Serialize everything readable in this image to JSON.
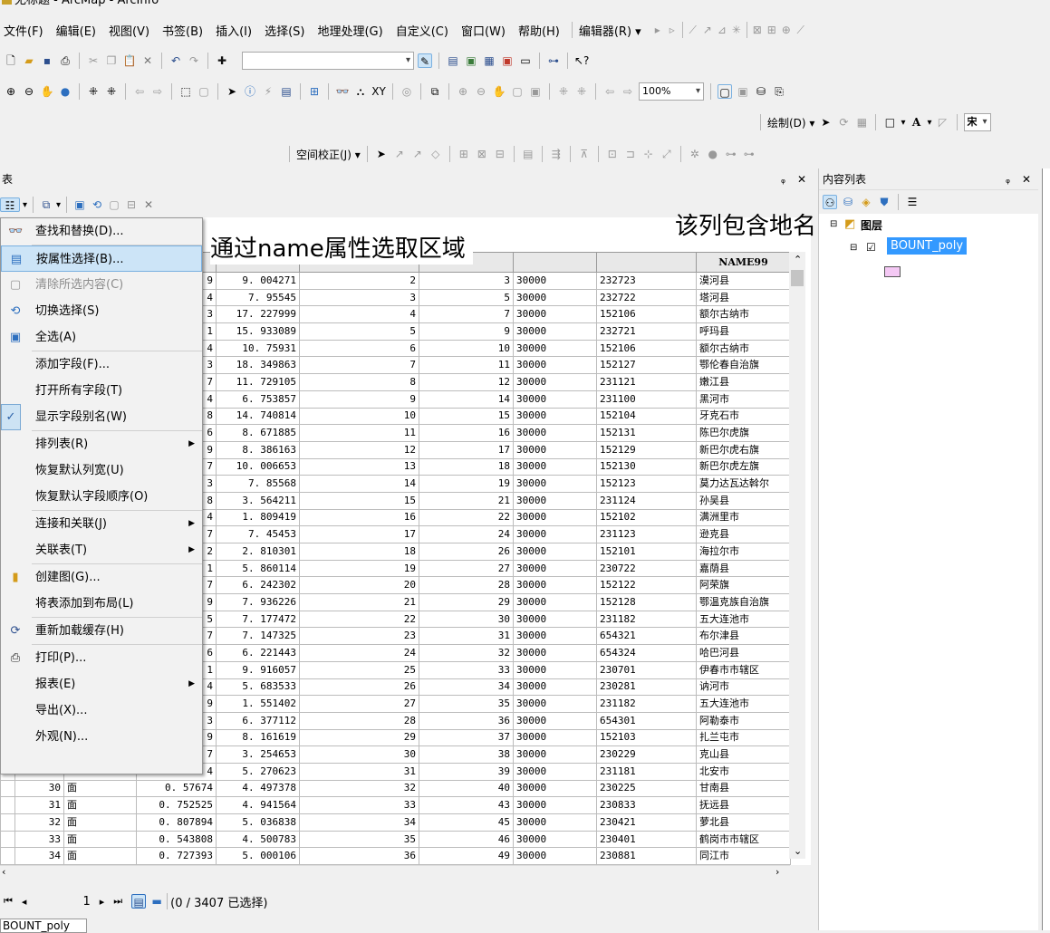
{
  "window": {
    "title": "无标题 - ArcMap - ArcInfo"
  },
  "menu": [
    "文件(F)",
    "编辑(E)",
    "视图(V)",
    "书签(B)",
    "插入(I)",
    "选择(S)",
    "地理处理(G)",
    "自定义(C)",
    "窗口(W)",
    "帮助(H)"
  ],
  "toolbars": {
    "editor_label": "编辑器(R)",
    "draw_label": "绘制(D)",
    "spatial_adjust_label": "空间校正(J)",
    "zoom_value": "100%",
    "font_partial": "宋"
  },
  "table_window": {
    "title": "表",
    "close_glyph": "✕",
    "pin_glyph": "ᵩ"
  },
  "context_menu": {
    "items": [
      {
        "label": "查找和替换(D)...",
        "icon": "binoculars-icon"
      },
      {
        "label": "按属性选择(B)...",
        "icon": "select-by-attributes-icon",
        "highlighted": true
      },
      {
        "label": "清除所选内容(C)",
        "icon": "clear-selection-icon",
        "disabled": true
      },
      {
        "label": "切换选择(S)",
        "icon": "switch-selection-icon"
      },
      {
        "label": "全选(A)",
        "icon": "select-all-icon"
      },
      {
        "label": "添加字段(F)...",
        "icon": ""
      },
      {
        "label": "打开所有字段(T)",
        "icon": ""
      },
      {
        "label": "显示字段别名(W)",
        "icon": "checkmark-icon",
        "checked": true
      },
      {
        "label": "排列表(R)",
        "icon": "",
        "submenu": true
      },
      {
        "label": "恢复默认列宽(U)",
        "icon": ""
      },
      {
        "label": "恢复默认字段顺序(O)",
        "icon": ""
      },
      {
        "label": "连接和关联(J)",
        "icon": "",
        "submenu": true
      },
      {
        "label": "关联表(T)",
        "icon": "",
        "submenu": true
      },
      {
        "label": "创建图(G)...",
        "icon": "bar-chart-icon"
      },
      {
        "label": "将表添加到布局(L)",
        "icon": ""
      },
      {
        "label": "重新加载缓存(H)",
        "icon": "reload-icon"
      },
      {
        "label": "打印(P)...",
        "icon": "printer-icon"
      },
      {
        "label": "报表(E)",
        "icon": "",
        "submenu": true
      },
      {
        "label": "导出(X)...",
        "icon": ""
      },
      {
        "label": "外观(N)...",
        "icon": ""
      }
    ]
  },
  "annotations": {
    "select_by_name": "通过name属性选取区域",
    "column_contains": "该列包含地名"
  },
  "table": {
    "last_header": "NAME99",
    "rows": [
      [
        "",
        "",
        "",
        "9",
        "9. 004271",
        "2",
        "3",
        "30000",
        "232723",
        "漠河县"
      ],
      [
        "",
        "",
        "",
        "4",
        "7. 95545",
        "3",
        "5",
        "30000",
        "232722",
        "塔河县"
      ],
      [
        "",
        "",
        "",
        "3",
        "17. 227999",
        "4",
        "7",
        "30000",
        "152106",
        "额尔古纳市"
      ],
      [
        "",
        "",
        "",
        "1",
        "15. 933089",
        "5",
        "9",
        "30000",
        "232721",
        "呼玛县"
      ],
      [
        "",
        "",
        "",
        "4",
        "10. 75931",
        "6",
        "10",
        "30000",
        "152106",
        "额尔古纳市"
      ],
      [
        "",
        "",
        "",
        "3",
        "18. 349863",
        "7",
        "11",
        "30000",
        "152127",
        "鄂伦春自治旗"
      ],
      [
        "",
        "",
        "",
        "7",
        "11. 729105",
        "8",
        "12",
        "30000",
        "231121",
        "嫩江县"
      ],
      [
        "",
        "",
        "",
        "4",
        "6. 753857",
        "9",
        "14",
        "30000",
        "231100",
        "黑河市"
      ],
      [
        "",
        "",
        "",
        "8",
        "14. 740814",
        "10",
        "15",
        "30000",
        "152104",
        "牙克石市"
      ],
      [
        "",
        "",
        "",
        "6",
        "8. 671885",
        "11",
        "16",
        "30000",
        "152131",
        "陈巴尔虎旗"
      ],
      [
        "",
        "",
        "",
        "9",
        "8. 386163",
        "12",
        "17",
        "30000",
        "152129",
        "新巴尔虎右旗"
      ],
      [
        "",
        "",
        "",
        "7",
        "10. 006653",
        "13",
        "18",
        "30000",
        "152130",
        "新巴尔虎左旗"
      ],
      [
        "",
        "",
        "",
        "3",
        "7. 85568",
        "14",
        "19",
        "30000",
        "152123",
        "莫力达瓦达斡尔"
      ],
      [
        "",
        "",
        "",
        "8",
        "3. 564211",
        "15",
        "21",
        "30000",
        "231124",
        "孙吴县"
      ],
      [
        "",
        "",
        "",
        "4",
        "1. 809419",
        "16",
        "22",
        "30000",
        "152102",
        "满洲里市"
      ],
      [
        "",
        "",
        "",
        "7",
        "7. 45453",
        "17",
        "24",
        "30000",
        "231123",
        "逊克县"
      ],
      [
        "",
        "",
        "",
        "2",
        "2. 810301",
        "18",
        "26",
        "30000",
        "152101",
        "海拉尔市"
      ],
      [
        "",
        "",
        "",
        "1",
        "5. 860114",
        "19",
        "27",
        "30000",
        "230722",
        "嘉荫县"
      ],
      [
        "",
        "",
        "",
        "7",
        "6. 242302",
        "20",
        "28",
        "30000",
        "152122",
        "阿荣旗"
      ],
      [
        "",
        "",
        "",
        "9",
        "7. 936226",
        "21",
        "29",
        "30000",
        "152128",
        "鄂温克族自治旗"
      ],
      [
        "",
        "",
        "",
        "5",
        "7. 177472",
        "22",
        "30",
        "30000",
        "231182",
        "五大连池市"
      ],
      [
        "",
        "",
        "",
        "7",
        "7. 147325",
        "23",
        "31",
        "30000",
        "654321",
        "布尔津县"
      ],
      [
        "",
        "",
        "",
        "6",
        "6. 221443",
        "24",
        "32",
        "30000",
        "654324",
        "哈巴河县"
      ],
      [
        "",
        "",
        "",
        "1",
        "9. 916057",
        "25",
        "33",
        "30000",
        "230701",
        "伊春市市辖区"
      ],
      [
        "",
        "",
        "",
        "4",
        "5. 683533",
        "26",
        "34",
        "30000",
        "230281",
        "讷河市"
      ],
      [
        "",
        "",
        "",
        "9",
        "1. 551402",
        "27",
        "35",
        "30000",
        "231182",
        "五大连池市"
      ],
      [
        "",
        "",
        "",
        "3",
        "6. 377112",
        "28",
        "36",
        "30000",
        "654301",
        "阿勒泰市"
      ],
      [
        "",
        "",
        "",
        "9",
        "8. 161619",
        "29",
        "37",
        "30000",
        "152103",
        "扎兰屯市"
      ],
      [
        "",
        "",
        "",
        "7",
        "3. 254653",
        "30",
        "38",
        "30000",
        "230229",
        "克山县"
      ],
      [
        "",
        "",
        "",
        "4",
        "5. 270623",
        "31",
        "39",
        "30000",
        "231181",
        "北安市"
      ],
      [
        "",
        "30",
        "面",
        "0. 57674",
        "4. 497378",
        "32",
        "40",
        "30000",
        "230225",
        "甘南县"
      ],
      [
        "",
        "31",
        "面",
        "0. 752525",
        "4. 941564",
        "33",
        "43",
        "30000",
        "230833",
        "抚远县"
      ],
      [
        "",
        "32",
        "面",
        "0. 807894",
        "5. 036838",
        "34",
        "45",
        "30000",
        "230421",
        "萝北县"
      ],
      [
        "",
        "33",
        "面",
        "0. 543808",
        "4. 500783",
        "35",
        "46",
        "30000",
        "230401",
        "鹤岗市市辖区"
      ],
      [
        "",
        "34",
        "面",
        "0. 727393",
        "5. 000106",
        "36",
        "49",
        "30000",
        "230881",
        "同江市"
      ]
    ]
  },
  "navigation": {
    "current": "1",
    "status": "(0 / 3407 已选择)"
  },
  "table_tab": "BOUNT_poly",
  "toc": {
    "title": "内容列表",
    "root": "图层",
    "layer": "BOUNT_poly",
    "swatch_color": "#f4c8f4"
  },
  "colors": {
    "highlight": "#cce4f7",
    "selected_layer": "#3399ff"
  }
}
